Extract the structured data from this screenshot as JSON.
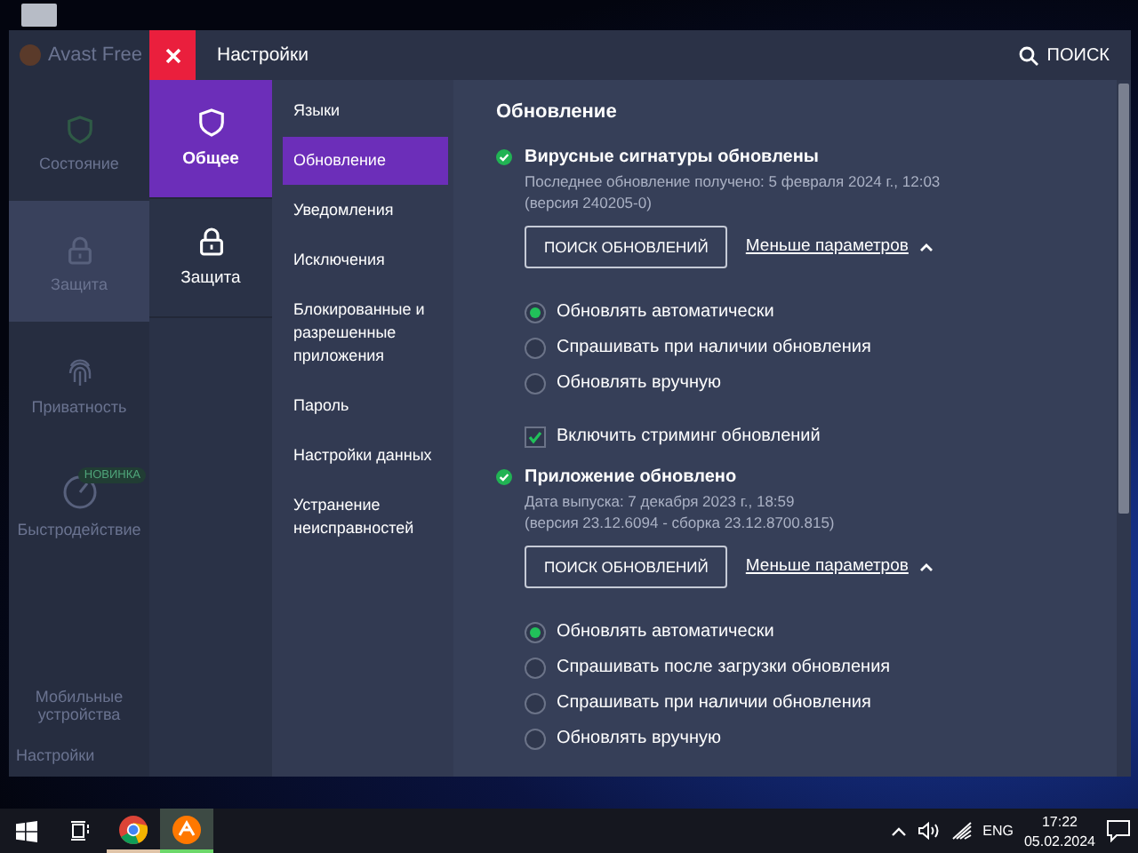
{
  "background_app": {
    "title": "Avast Free",
    "items": [
      {
        "label": "Состояние",
        "selected": false
      },
      {
        "label": "Защита",
        "selected": true
      },
      {
        "label": "Приватность",
        "selected": false
      },
      {
        "label": "Быстродействие",
        "selected": false,
        "badge": "НОВИНКА"
      }
    ],
    "bottom_items": [
      "Мобильные устройства",
      "Настройки"
    ]
  },
  "settings": {
    "title": "Настройки",
    "search_label": "ПОИСК",
    "categories": [
      {
        "label": "Общее",
        "selected": true
      },
      {
        "label": "Защита",
        "selected": false
      }
    ],
    "submenu": [
      {
        "label": "Языки",
        "selected": false
      },
      {
        "label": "Обновление",
        "selected": true
      },
      {
        "label": "Уведомления",
        "selected": false
      },
      {
        "label": "Исключения",
        "selected": false
      },
      {
        "label": "Блокированные и разрешенные приложения",
        "selected": false
      },
      {
        "label": "Пароль",
        "selected": false
      },
      {
        "label": "Настройки данных",
        "selected": false
      },
      {
        "label": "Устранение неисправностей",
        "selected": false
      }
    ],
    "content": {
      "heading": "Обновление",
      "sections": [
        {
          "title": "Вирусные сигнатуры обновлены",
          "details": [
            "Последнее обновление получено: 5 февраля 2024 г., 12:03",
            "(версия 240205-0)"
          ],
          "button": "ПОИСК ОБНОВЛЕНИЙ",
          "toggle": "Меньше параметров",
          "expanded": true,
          "options": [
            {
              "kind": "radio",
              "label": "Обновлять автоматически",
              "selected": true
            },
            {
              "kind": "radio",
              "label": "Спрашивать при наличии обновления",
              "selected": false
            },
            {
              "kind": "radio",
              "label": "Обновлять вручную",
              "selected": false
            },
            {
              "kind": "checkbox",
              "label": "Включить стриминг обновлений",
              "checked": true
            }
          ]
        },
        {
          "title": "Приложение обновлено",
          "details": [
            "Дата выпуска: 7 декабря 2023 г., 18:59",
            "(версия 23.12.6094 - сборка 23.12.8700.815)"
          ],
          "button": "ПОИСК ОБНОВЛЕНИЙ",
          "toggle": "Меньше параметров",
          "expanded": true,
          "options": [
            {
              "kind": "radio",
              "label": "Обновлять автоматически",
              "selected": true
            },
            {
              "kind": "radio",
              "label": "Спрашивать после загрузки обновления",
              "selected": false
            },
            {
              "kind": "radio",
              "label": "Спрашивать при наличии обновления",
              "selected": false
            },
            {
              "kind": "radio",
              "label": "Обновлять вручную",
              "selected": false
            }
          ]
        }
      ]
    }
  },
  "taskbar": {
    "apps": [
      {
        "kind": "browser",
        "active": false
      },
      {
        "kind": "antivirus",
        "active": true
      }
    ],
    "language": "ENG",
    "time": "17:22",
    "date": "05.02.2024"
  }
}
